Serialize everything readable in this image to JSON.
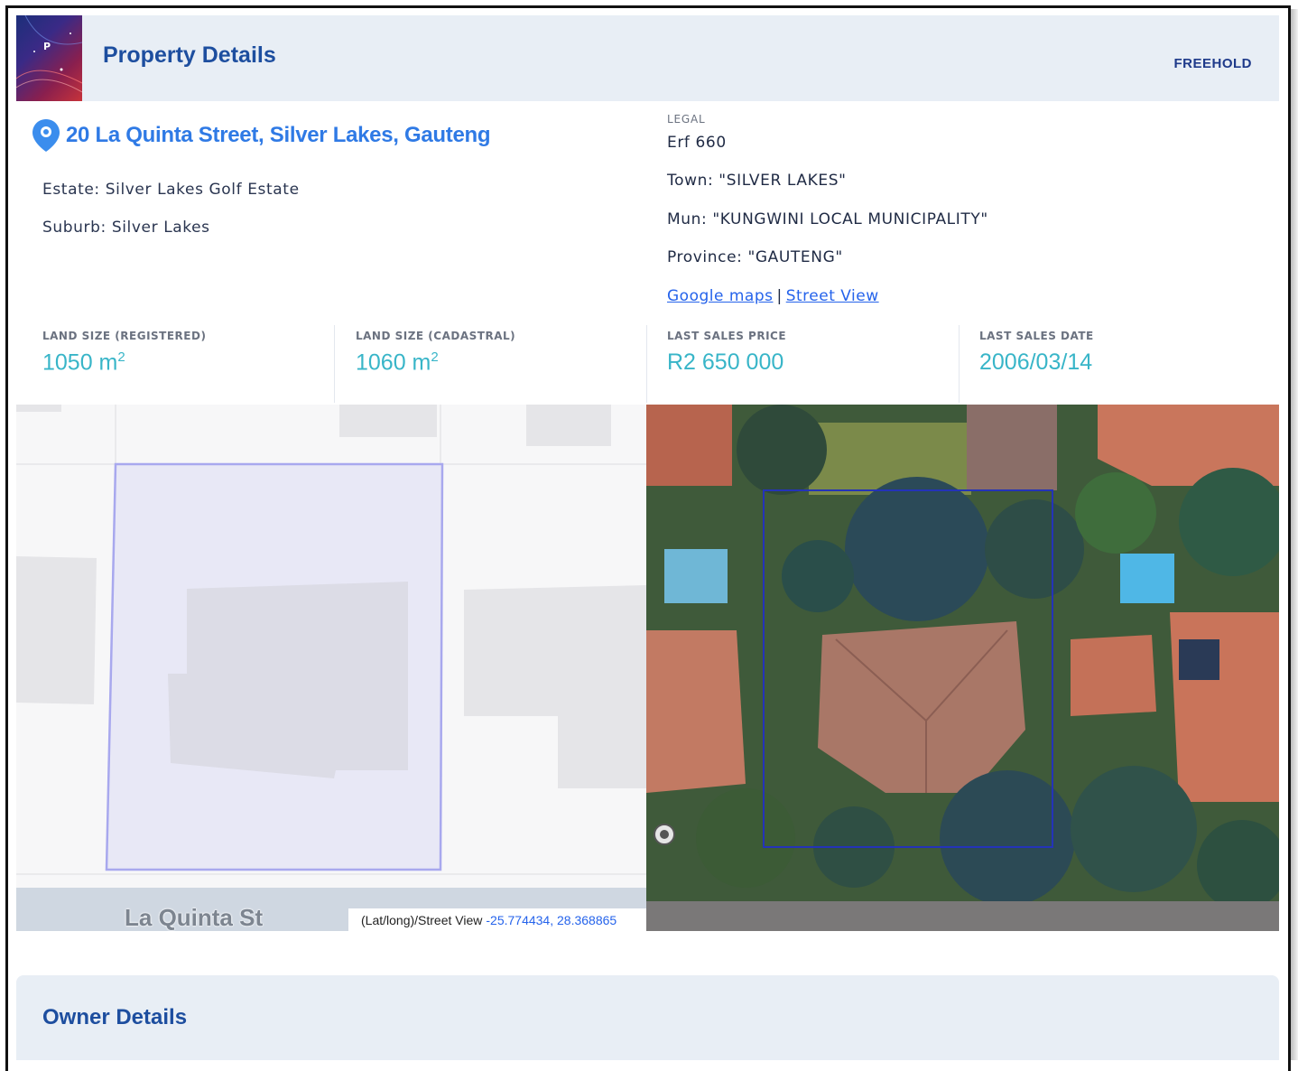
{
  "header": {
    "logo_letter": "P",
    "title": "Property Details",
    "tenure": "FREEHOLD"
  },
  "address": {
    "icon": "location-pin-icon",
    "text": "20 La Quinta Street, Silver Lakes, Gauteng",
    "estate": "Estate: Silver Lakes Golf Estate",
    "suburb": "Suburb: Silver Lakes"
  },
  "legal": {
    "label": "LEGAL",
    "erf": "Erf 660",
    "town": "Town: \"SILVER LAKES\"",
    "mun": "Mun: \"KUNGWINI LOCAL MUNICIPALITY\"",
    "province": "Province: \"GAUTENG\"",
    "google_maps": "Google maps",
    "separator": "|",
    "street_view": "Street View"
  },
  "stats": {
    "land_registered_label": "LAND SIZE (REGISTERED)",
    "land_registered_value": "1050 m",
    "land_cadastral_label": "LAND SIZE (CADASTRAL)",
    "land_cadastral_value": "1060 m",
    "unit_sup": "2",
    "last_price_label": "LAST SALES PRICE",
    "last_price_value": "R2 650 000",
    "last_date_label": "LAST SALES DATE",
    "last_date_value": "2006/03/14"
  },
  "map": {
    "street_name": "La Quinta St",
    "coords_label": "(Lat/long)/Street View",
    "coords_value": "-25.774434, 28.368865"
  },
  "owner": {
    "title": "Owner Details"
  },
  "colors": {
    "accent_blue": "#1d4e9f",
    "address_blue": "#2f7ae5",
    "stat_teal": "#38b5c8",
    "header_bg": "#e8eef5"
  }
}
